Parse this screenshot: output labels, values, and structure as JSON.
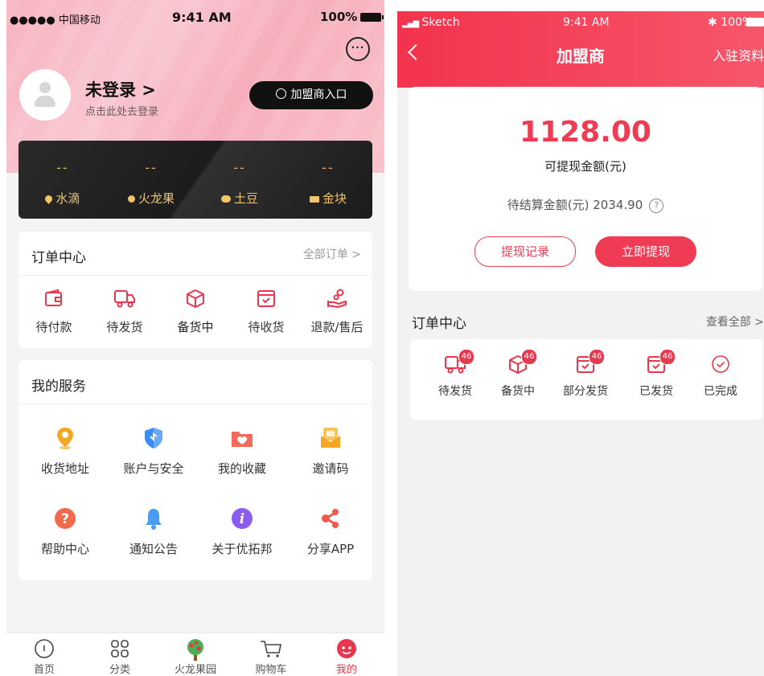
{
  "left": {
    "status": {
      "carrier": "●●●●● 中国移动",
      "time": "9:41 AM",
      "battery": "100%"
    },
    "profile": {
      "name": "未登录 >",
      "hint": "点击此处去登录"
    },
    "franchise_button": "加盟商入口",
    "assets": [
      {
        "value": "--",
        "label": "水滴"
      },
      {
        "value": "--",
        "label": "火龙果"
      },
      {
        "value": "--",
        "label": "土豆"
      },
      {
        "value": "--",
        "label": "金块"
      }
    ],
    "orders": {
      "title": "订单中心",
      "more": "全部订单 >",
      "items": [
        {
          "label": "待付款",
          "icon": "wallet-icon"
        },
        {
          "label": "待发货",
          "icon": "truck-icon"
        },
        {
          "label": "备货中",
          "icon": "box-icon"
        },
        {
          "label": "待收货",
          "icon": "receive-box-icon"
        },
        {
          "label": "退款/售后",
          "icon": "refund-hand-icon"
        }
      ]
    },
    "services": {
      "title": "我的服务",
      "items": [
        {
          "label": "收货地址",
          "icon": "location-pin-icon"
        },
        {
          "label": "账户与安全",
          "icon": "shield-icon"
        },
        {
          "label": "我的收藏",
          "icon": "heart-folder-icon"
        },
        {
          "label": "邀请码",
          "icon": "invite-envelope-icon"
        },
        {
          "label": "帮助中心",
          "icon": "help-icon"
        },
        {
          "label": "通知公告",
          "icon": "bell-icon"
        },
        {
          "label": "关于优拓邦",
          "icon": "info-icon"
        },
        {
          "label": "分享APP",
          "icon": "share-icon"
        }
      ]
    },
    "tabs": [
      {
        "label": "首页",
        "icon": "home-icon"
      },
      {
        "label": "分类",
        "icon": "category-icon"
      },
      {
        "label": "火龙果园",
        "icon": "orchard-icon"
      },
      {
        "label": "购物车",
        "icon": "cart-icon"
      },
      {
        "label": "我的",
        "icon": "profile-icon"
      }
    ]
  },
  "right": {
    "status": {
      "carrier": "Sketch",
      "time": "9:41 AM",
      "battery": "100%"
    },
    "nav": {
      "title": "加盟商",
      "right": "入驻资料"
    },
    "wallet": {
      "amount": "1128.00",
      "amount_label": "可提现金额(元)",
      "pending": "待结算金额(元) 2034.90",
      "record_button": "提现记录",
      "withdraw_button": "立即提现"
    },
    "orders": {
      "title": "订单中心",
      "more": "查看全部 >",
      "items": [
        {
          "label": "待发货",
          "badge": "46",
          "icon": "truck-icon"
        },
        {
          "label": "备货中",
          "badge": "46",
          "icon": "box-icon"
        },
        {
          "label": "部分发货",
          "badge": "46",
          "icon": "receive-box-icon"
        },
        {
          "label": "已发货",
          "badge": "46",
          "icon": "receive-box-icon"
        },
        {
          "label": "已完成",
          "badge": "",
          "icon": "check-circle-icon"
        }
      ]
    }
  },
  "colors": {
    "accent": "#ef3b53",
    "gold": "#f2c46a",
    "header_pink": "#f7b3bf"
  }
}
